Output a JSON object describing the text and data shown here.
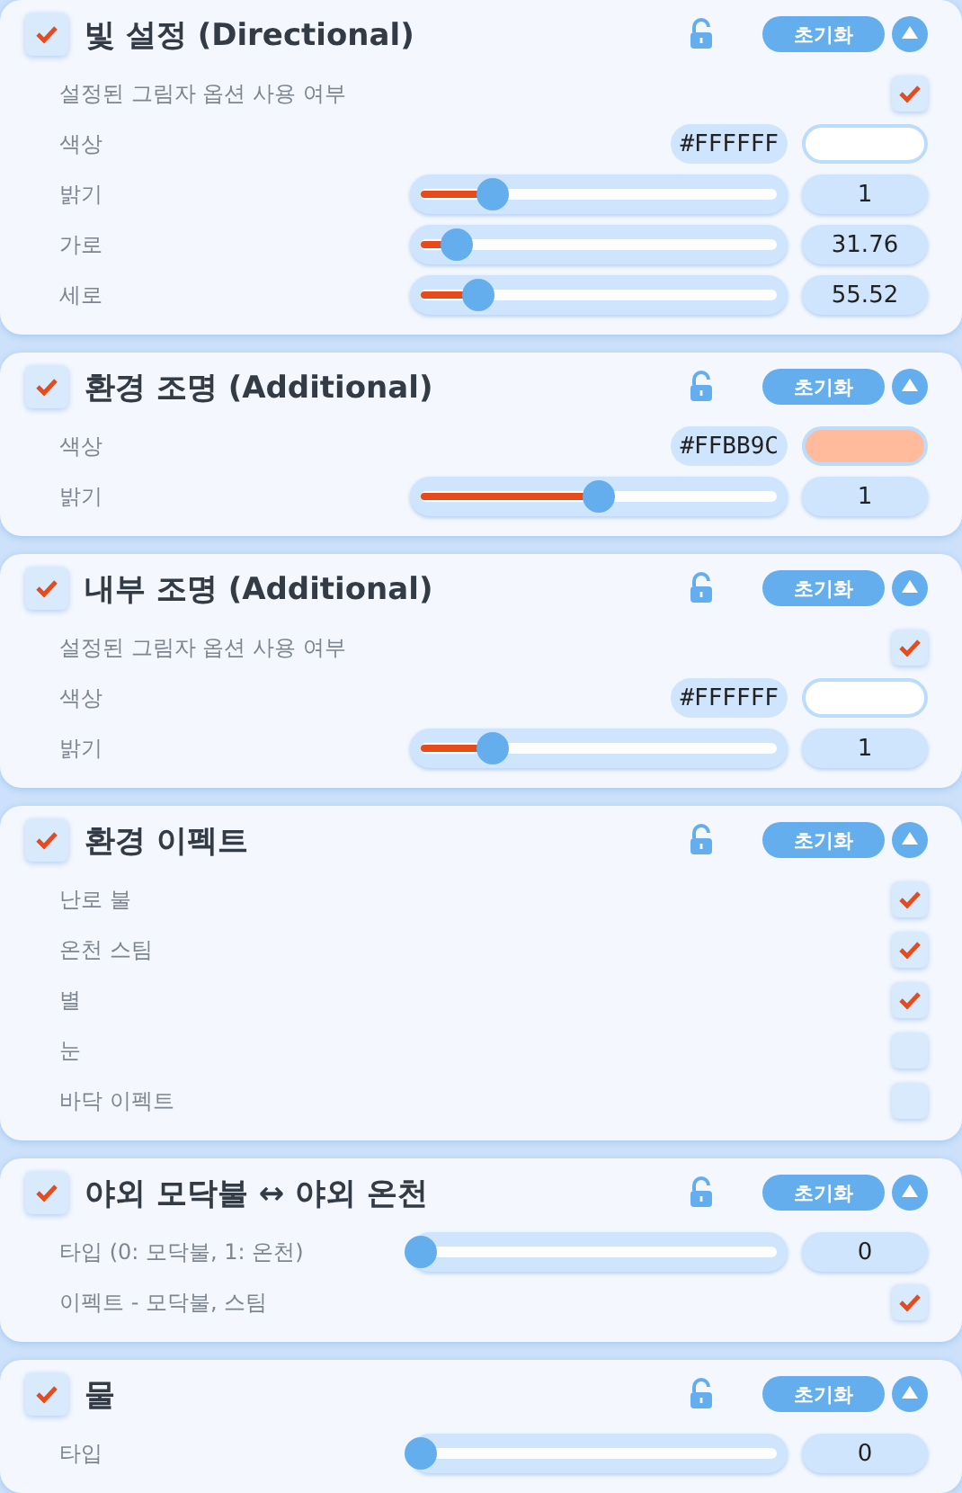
{
  "panels": [
    {
      "title": "빛 설정 (Directional)",
      "enabled": true,
      "reset_label": "초기화",
      "rows": [
        {
          "kind": "checkbox",
          "label": "설정된 그림자 옵션 사용 여부",
          "checked": true
        },
        {
          "kind": "color",
          "label": "색상",
          "hex": "#FFFFFF",
          "color": "#ffffff"
        },
        {
          "kind": "slider",
          "label": "밝기",
          "level": 0.2,
          "value": "1"
        },
        {
          "kind": "slider",
          "label": "가로",
          "level": 0.1,
          "value": "31.76"
        },
        {
          "kind": "slider",
          "label": "세로",
          "level": 0.16,
          "value": "55.52"
        }
      ]
    },
    {
      "title": "환경 조명 (Additional)",
      "enabled": true,
      "reset_label": "초기화",
      "rows": [
        {
          "kind": "color",
          "label": "색상",
          "hex": "#FFBB9C",
          "color": "#ffbb9c"
        },
        {
          "kind": "slider",
          "label": "밝기",
          "level": 0.5,
          "value": "1"
        }
      ]
    },
    {
      "title": "내부 조명 (Additional)",
      "enabled": true,
      "reset_label": "초기화",
      "rows": [
        {
          "kind": "checkbox",
          "label": "설정된 그림자 옵션 사용 여부",
          "checked": true
        },
        {
          "kind": "color",
          "label": "색상",
          "hex": "#FFFFFF",
          "color": "#ffffff"
        },
        {
          "kind": "slider",
          "label": "밝기",
          "level": 0.2,
          "value": "1"
        }
      ]
    },
    {
      "title": "환경 이펙트",
      "enabled": true,
      "reset_label": "초기화",
      "rows": [
        {
          "kind": "checkbox",
          "label": "난로 불",
          "checked": true
        },
        {
          "kind": "checkbox",
          "label": "온천 스팀",
          "checked": true
        },
        {
          "kind": "checkbox",
          "label": "별",
          "checked": true
        },
        {
          "kind": "checkbox",
          "label": "눈",
          "checked": false
        },
        {
          "kind": "checkbox",
          "label": "바닥 이펙트",
          "checked": false
        }
      ]
    },
    {
      "title": "야외 모닥불 ↔ 야외 온천",
      "enabled": true,
      "reset_label": "초기화",
      "rows": [
        {
          "kind": "slider",
          "label": "타입 (0:  모닥불, 1: 온천)",
          "level": 0,
          "value": "0"
        },
        {
          "kind": "checkbox",
          "label": "이펙트 - 모닥불, 스팀",
          "checked": true
        }
      ]
    },
    {
      "title": "물",
      "enabled": true,
      "reset_label": "초기화",
      "rows": [
        {
          "kind": "slider",
          "label": "타입",
          "level": 0,
          "value": "0"
        }
      ]
    }
  ]
}
